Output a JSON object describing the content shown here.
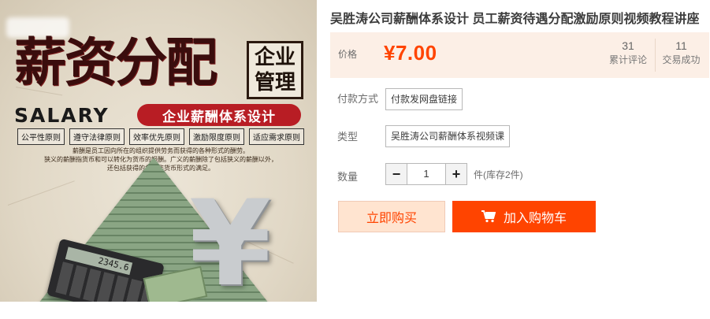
{
  "product": {
    "title": "吴胜涛公司薪酬体系设计 员工薪资待遇分配激励原则视频教程讲座",
    "price_label": "价格",
    "price": "¥7.00",
    "reviews_count": "31",
    "reviews_label": "累计评论",
    "sales_count": "11",
    "sales_label": "交易成功"
  },
  "options": {
    "payment_label": "付款方式",
    "payment_value": "付款发网盘链接",
    "type_label": "类型",
    "type_value": "吴胜涛公司薪酬体系视频课",
    "quantity_label": "数量",
    "quantity_value": "1",
    "quantity_minus": "−",
    "quantity_plus": "+",
    "stock_text": "件(库存2件)"
  },
  "actions": {
    "buy_now": "立即购买",
    "add_to_cart": "加入购物车"
  },
  "hero_image": {
    "headline": "薪资分配",
    "badge_line1": "企业",
    "badge_line2": "管理",
    "salary_text": "SALARY",
    "subtitle": "企业薪酬体系设计",
    "principles": [
      "公平性原则",
      "遵守法律原则",
      "效率优先原则",
      "激励限度原则",
      "适应需求原则"
    ],
    "description_line1": "薪酬是员工因向所在的组织提供劳务而获得的各种形式的酬劳。",
    "description_line2": "狭义的薪酬指货币和可以转化为货币的报酬。广义的薪酬除了包括狭义的薪酬以外，",
    "description_line3": "还包括获得的各种非货币形式的满足。",
    "calculator_display": "2345.6",
    "yen_symbol": "¥"
  },
  "colors": {
    "accent": "#ff4400",
    "price_bg": "#fcefe6",
    "buy_bg": "#ffe4d0",
    "hero_red": "#b81d24"
  }
}
